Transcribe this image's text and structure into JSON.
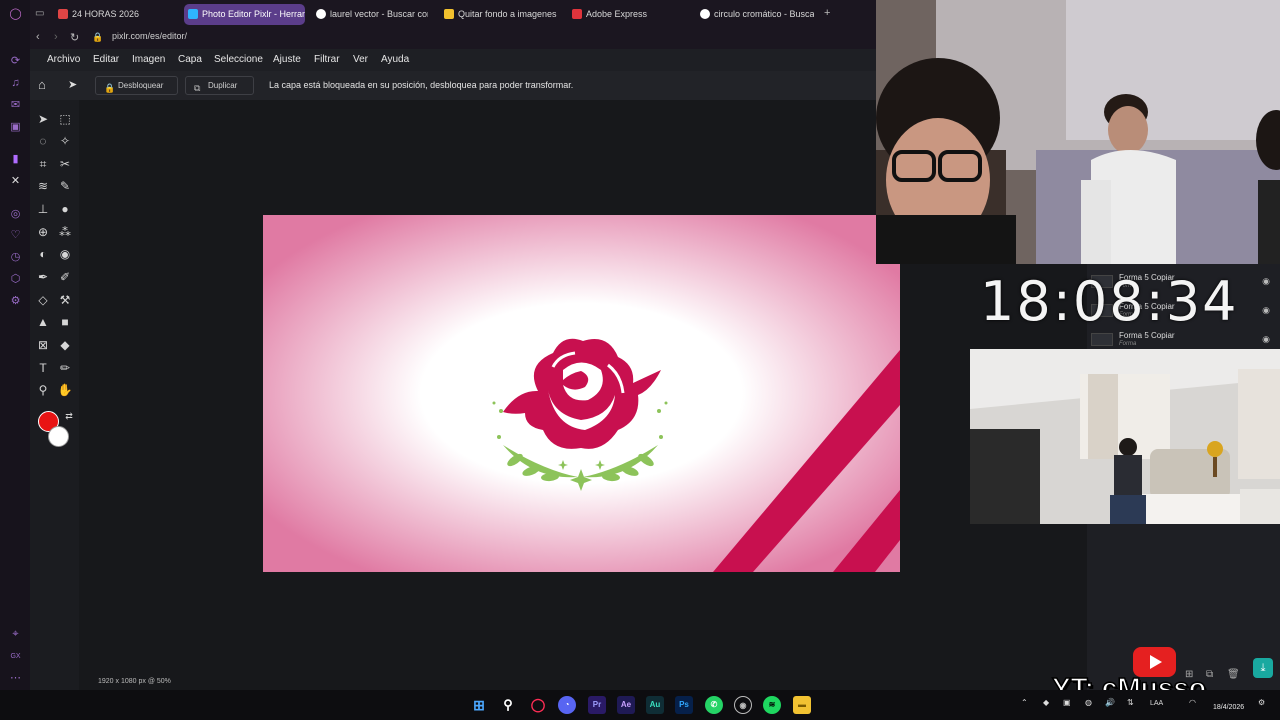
{
  "browser": {
    "tabs": [
      {
        "label": "24 HORAS 2026",
        "fav_color": "#e04545"
      },
      {
        "label": "Photo Editor Pixlr - Herramienta",
        "fav_color": "#2fb4ff"
      },
      {
        "label": "laurel vector - Buscar con Google",
        "fav_color": "#ffffff"
      },
      {
        "label": "Quitar fondo a imagenes en línea",
        "fav_color": "#f2c12e"
      },
      {
        "label": "Adobe Express",
        "fav_color": "#e0343c"
      },
      {
        "label": "circulo cromático - Buscar con Google",
        "fav_color": "#ffffff"
      }
    ],
    "new_tab_icon": "plus-icon",
    "url": "pixlr.com/es/editor/"
  },
  "editor": {
    "menu": [
      "Archivo",
      "Editar",
      "Imagen",
      "Capa",
      "Seleccione",
      "Ajuste",
      "Filtrar",
      "Ver",
      "Ayuda"
    ],
    "unlock_label": "Desbloquear",
    "duplicate_label": "Duplicar",
    "lock_message": "La capa está bloqueada en su posición, desbloquea para poder transformar.",
    "zoom_info": "1920 x 1080 px @ 50%",
    "primary_color": "#e81414",
    "secondary_color": "#ffffff",
    "layers": [
      {
        "name": "Forma 5 Copiar",
        "type": "Forma"
      },
      {
        "name": "Forma 5 Copiar",
        "type": "Forma"
      },
      {
        "name": "Forma 5 Copiar",
        "type": "Forma"
      }
    ]
  },
  "artwork": {
    "background_edge": "#e07aa3",
    "rose_color": "#c8104f",
    "laurel_color": "#8dc35a",
    "stripe_color": "#c8104f"
  },
  "overlay": {
    "timer": "18:08:34",
    "channel": "YT: cMusso"
  },
  "taskbar": {
    "time": "18/4/2026"
  }
}
